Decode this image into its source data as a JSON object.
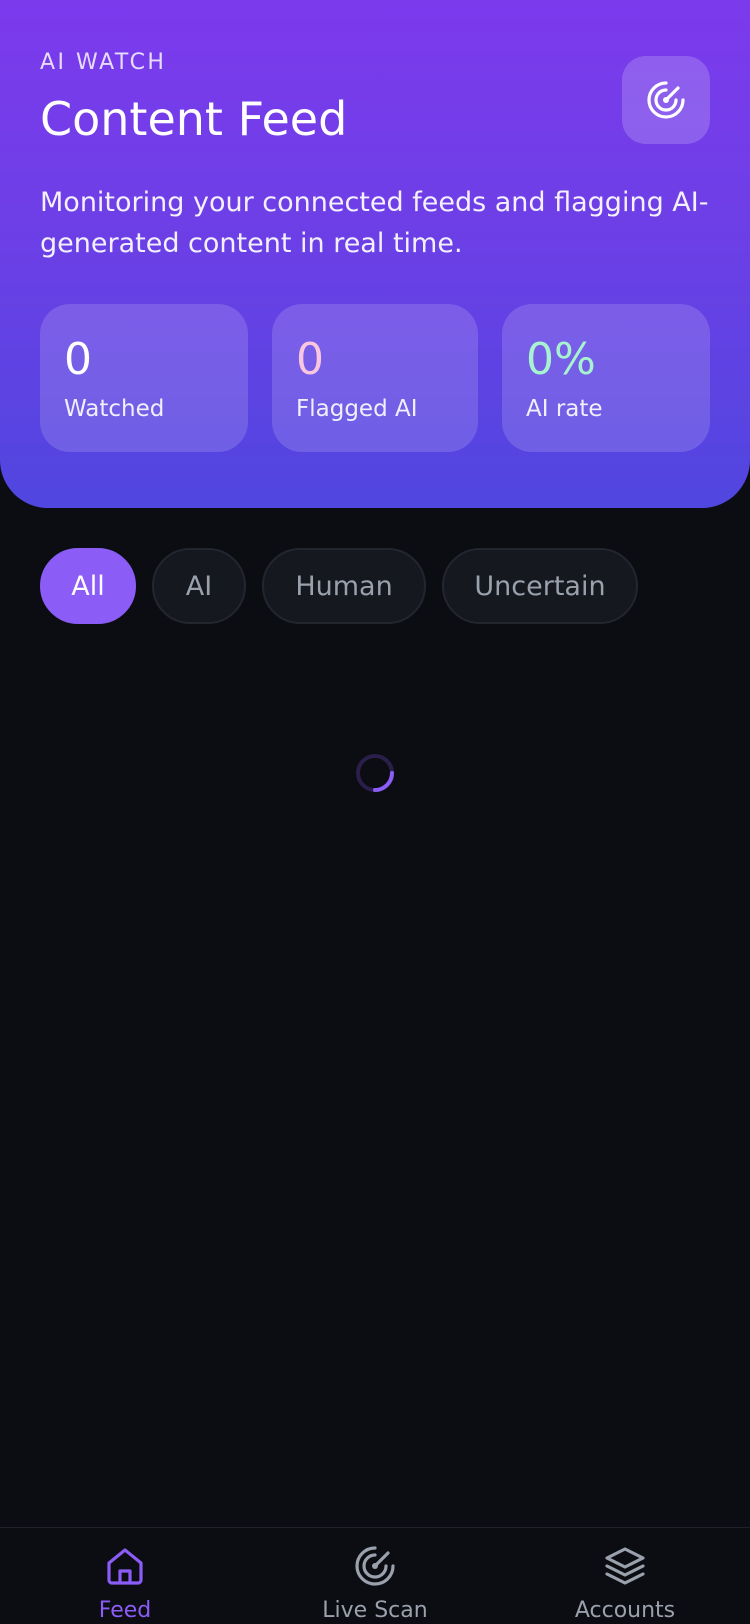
{
  "header": {
    "eyebrow": "AI WATCH",
    "title": "Content Feed",
    "subtitle": "Monitoring your connected feeds and flagging AI-generated content in real time.",
    "action_icon": "radar-icon"
  },
  "stats": [
    {
      "value": "0",
      "label": "Watched",
      "color": "#ffffff"
    },
    {
      "value": "0",
      "label": "Flagged AI",
      "color": "#f9c6e0"
    },
    {
      "value": "0%",
      "label": "AI rate",
      "color": "#a7f3d0"
    }
  ],
  "filters": {
    "selected": "All",
    "items": [
      "All",
      "AI",
      "Human",
      "Uncertain"
    ]
  },
  "nav": [
    {
      "label": "Feed",
      "icon": "home-icon",
      "active": true
    },
    {
      "label": "Live Scan",
      "icon": "radar-icon",
      "active": false
    },
    {
      "label": "Accounts",
      "icon": "layers-icon",
      "active": false
    }
  ],
  "colors": {
    "accent": "#8b5cf6",
    "header_gradient_top": "#7c3aed",
    "header_gradient_bottom": "#5046e0",
    "background": "#0b0d12"
  }
}
